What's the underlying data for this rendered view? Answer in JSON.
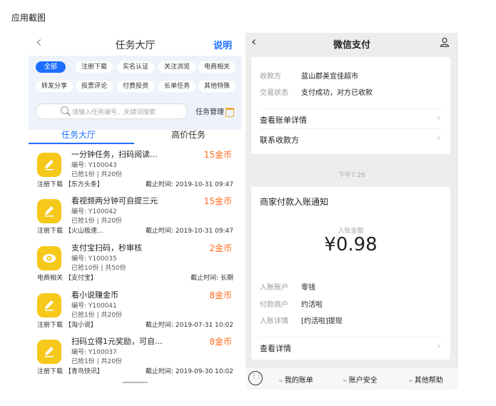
{
  "caption": "应用截图",
  "left": {
    "header": {
      "back_icon": "chevron-left-icon",
      "title": "任务大厅",
      "help": "说明"
    },
    "tags": [
      "全部",
      "注册下载",
      "实名认证",
      "关注浏览",
      "电商相关",
      "转发分享",
      "投票评论",
      "付费投资",
      "长单任务",
      "其他特殊"
    ],
    "search": {
      "placeholder": "请输入任务编号、关键词搜索",
      "manage": "任务管理"
    },
    "tabs": [
      "任务大厅",
      "高价任务"
    ],
    "tasks": [
      {
        "name": "一分钟任务，扫码阅读...",
        "coin": "15金币",
        "code": "编号: Y100043",
        "stat": "已抢1份 | 共20份",
        "cat": "注册下载  【东方头条】",
        "deadline": "截止时间: 2019-10-31 09:47",
        "icon": "pencil-icon"
      },
      {
        "name": "看视频两分钟可自提三元",
        "coin": "15金币",
        "code": "编号: Y100042",
        "stat": "已抢1份 | 共20份",
        "cat": "注册下载  【火山极速...",
        "deadline": "截止时间: 2019-10-31 09:47",
        "icon": "pencil-icon"
      },
      {
        "name": "支付宝扫码，秒审核",
        "coin": "2金币",
        "code": "编号: Y100035",
        "stat": "已抢10份 | 共50份",
        "cat": "电商相关  【支付宝】",
        "deadline": "截止时间: 长期",
        "icon": "eye-icon"
      },
      {
        "name": "看小说赚金币",
        "coin": "8金币",
        "code": "编号: Y100041",
        "stat": "已抢1份 | 共20份",
        "cat": "注册下载  【淘小说】",
        "deadline": "截止时间: 2019-07-31 10:02",
        "icon": "pencil-icon"
      },
      {
        "name": "扫码立得1元奖励，可自...",
        "coin": "8金币",
        "code": "编号: Y100037",
        "stat": "已抢1份 | 共20份",
        "cat": "注册下载  【青鸟快讯】",
        "deadline": "截止时间: 2019-09-30 10:02",
        "icon": "pencil-icon"
      }
    ]
  },
  "right": {
    "header": {
      "title": "微信支付",
      "back_icon": "chevron-left-icon",
      "user_icon": "user-icon"
    },
    "top": {
      "payee_label": "收款方",
      "payee_value": "蓝山郡美宜佳超市",
      "status_label": "交易状态",
      "status_value": "支付成功，对方已收款",
      "bill_detail": "查看账单详情",
      "contact": "联系收款方"
    },
    "time": "下午7:26",
    "notice": {
      "title": "商家付款入账通知",
      "amount_label": "入账金额",
      "amount": "¥0.98",
      "account_label": "入账账户",
      "account_value": "零钱",
      "merchant_label": "付款商户",
      "merchant_value": "约活啦",
      "detail_label": "入账详情",
      "detail_value": "[约活啦]提现",
      "view_detail": "查看详情"
    },
    "bottom": [
      "我的账单",
      "账户安全",
      "其他帮助"
    ]
  },
  "colors": {
    "accent": "#1e6fff",
    "coin": "#ff6a1a",
    "icon_bg": "#f6c81a"
  }
}
